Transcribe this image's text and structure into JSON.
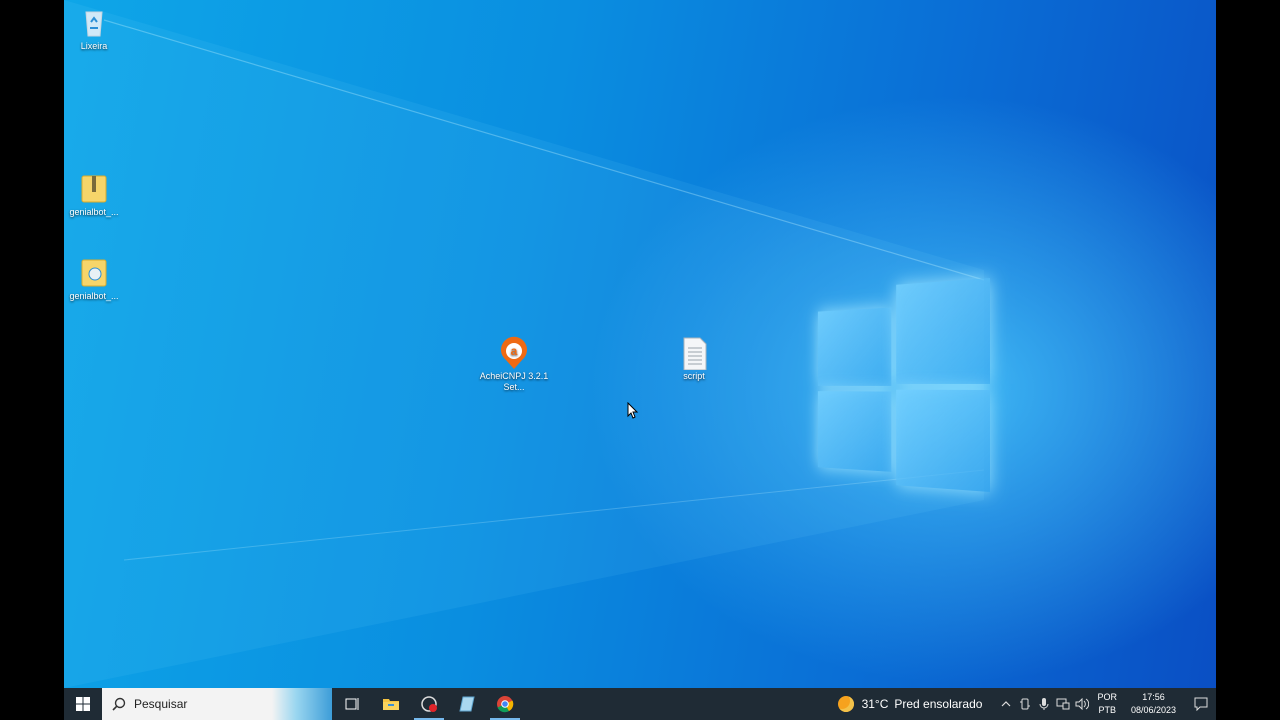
{
  "desktop": {
    "icons": [
      {
        "label": "Lixeira",
        "type": "recycle-bin"
      },
      {
        "label": "genialbot_...",
        "type": "zip-folder"
      },
      {
        "label": "genialbot_...",
        "type": "zip-setup"
      },
      {
        "label": "AcheiCNPJ 3.2.1 Set...",
        "type": "acheicnpj-app"
      },
      {
        "label": "script",
        "type": "text-file"
      }
    ]
  },
  "taskbar": {
    "search_placeholder": "Pesquisar",
    "apps": [
      "task-view",
      "file-explorer",
      "screen-recorder",
      "notepad",
      "chrome"
    ],
    "weather": {
      "temp": "31°C",
      "desc": "Pred ensolarado"
    },
    "language": {
      "line1": "POR",
      "line2": "PTB"
    },
    "clock": {
      "time": "17:56",
      "date": "08/06/2023"
    }
  },
  "colors": {
    "taskbar": "#1f2b35",
    "accent": "#76b9ed",
    "desktop": "#0a8ee0"
  }
}
